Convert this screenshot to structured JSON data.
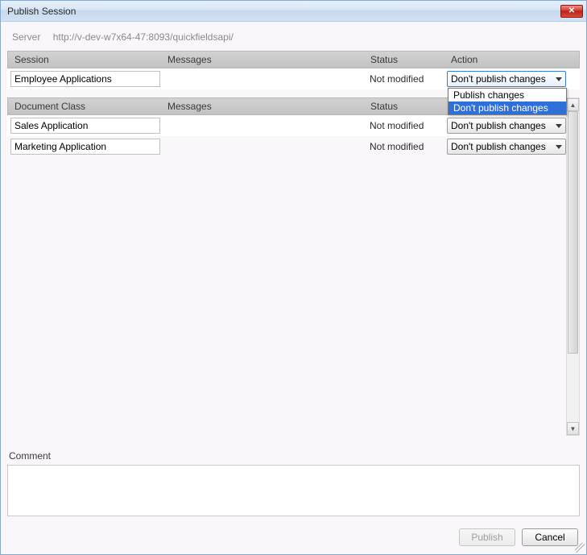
{
  "window": {
    "title": "Publish Session"
  },
  "server": {
    "label": "Server",
    "url": "http://v-dev-w7x64-47:8093/quickfieldsapi/"
  },
  "headers": {
    "session": "Session",
    "docclass": "Document Class",
    "messages": "Messages",
    "status": "Status",
    "action": "Action"
  },
  "session_row": {
    "name": "Employee Applications",
    "status": "Not modified",
    "action": "Don't publish changes",
    "dropdown": {
      "open": true,
      "options": [
        "Publish changes",
        "Don't publish changes"
      ],
      "highlighted": "Don't publish changes"
    }
  },
  "doc_rows": [
    {
      "name": "Sales Application",
      "status": "Not modified",
      "action": "Don't publish changes"
    },
    {
      "name": "Marketing Application",
      "status": "Not modified",
      "action": "Don't publish changes"
    }
  ],
  "comment": {
    "label": "Comment",
    "value": ""
  },
  "buttons": {
    "publish": "Publish",
    "cancel": "Cancel"
  }
}
